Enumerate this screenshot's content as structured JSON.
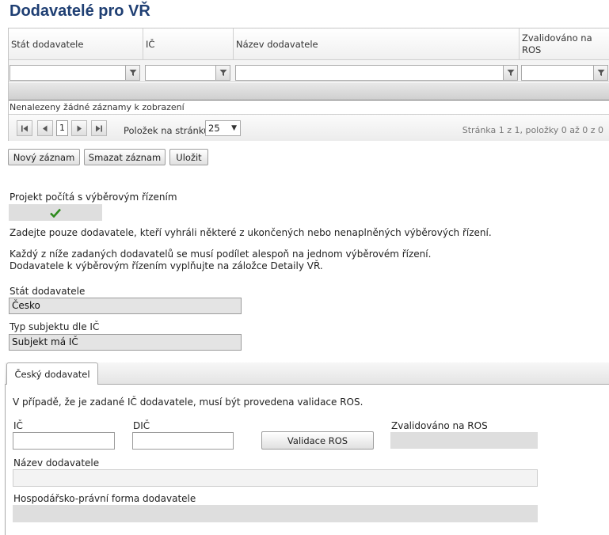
{
  "page": {
    "title": "Dodavatelé pro VŘ"
  },
  "grid": {
    "columns": [
      "Stát dodavatele",
      "IČ",
      "Název dodavatele",
      "Zvalidováno na ROS"
    ],
    "empty_message": "Nenalezeny žádné záznamy k zobrazení",
    "pager": {
      "first_icon": "first-page-icon",
      "prev_icon": "prev-page-icon",
      "next_icon": "next-page-icon",
      "last_icon": "last-page-icon",
      "current_page": "1",
      "page_size_label": "Položek na stránku",
      "page_size": "25",
      "info": "Stránka 1 z 1, položky 0 až 0 z 0"
    }
  },
  "toolbar": {
    "new_label": "Nový záznam",
    "delete_label": "Smazat záznam",
    "save_label": "Uložit"
  },
  "form": {
    "project_tender_label": "Projekt počítá s výběrovým řízením",
    "project_tender_checked": true,
    "info_line1": "Zadejte pouze dodavatele, kteří vyhráli některé z ukončených nebo nenaplněných výběrových řízení.",
    "info_line2": "Každý z níže zadaných dodavatelů se musí podílet alespoň na jednom výběrovém řízení.",
    "info_line3": "Dodavatele k výběrovým řízením vyplňujte na záložce Detaily VŘ.",
    "country_label": "Stát dodavatele",
    "country_value": "Česko",
    "subject_type_label": "Typ subjektu dle IČ",
    "subject_type_value": "Subjekt má IČ"
  },
  "tab": {
    "label": "Český dodavatel",
    "note": "V případě, že je zadané IČ dodavatele, musí být provedena validace ROS.",
    "ic_label": "IČ",
    "ic_value": "",
    "dic_label": "DIČ",
    "dic_value": "",
    "validate_button": "Validace ROS",
    "validated_label": "Zvalidováno na ROS",
    "name_label": "Název dodavatele",
    "legal_form_label": "Hospodářsko-právní forma dodavatele"
  },
  "colors": {
    "title": "#1f3f73",
    "checkmark": "#2e8b1e",
    "readonly_bg": "#e4e4e4"
  }
}
